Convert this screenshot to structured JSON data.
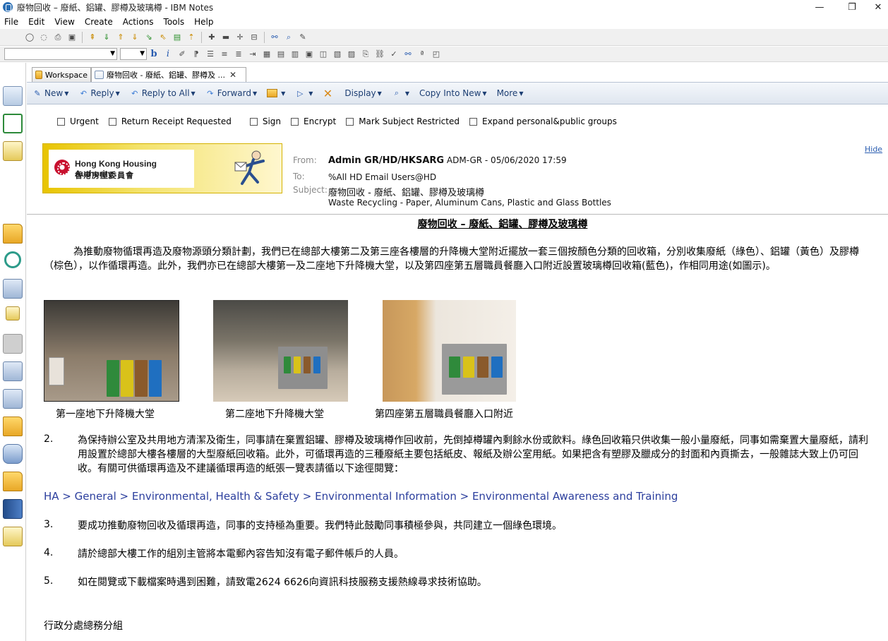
{
  "window": {
    "title": "廢物回收 – 廢紙、鋁罐、膠樽及玻璃樽 - IBM Notes",
    "min": "—",
    "max": "❐",
    "close": "✕"
  },
  "menu": [
    "File",
    "Edit",
    "View",
    "Create",
    "Actions",
    "Tools",
    "Help"
  ],
  "tabs": [
    {
      "label": "Workspace"
    },
    {
      "label": "廢物回收 - 廢紙、鋁罐、膠樽及 ..."
    }
  ],
  "tab_close": "✕",
  "actions": {
    "new": "New",
    "reply": "Reply",
    "reply_all": "Reply to All",
    "forward": "Forward",
    "display": "Display",
    "copy_into_new": "Copy Into New",
    "more": "More"
  },
  "options": {
    "urgent": "Urgent",
    "return_receipt": "Return Receipt Requested",
    "sign": "Sign",
    "encrypt": "Encrypt",
    "mark_subject_restricted": "Mark Subject Restricted",
    "expand_groups": "Expand personal&public groups"
  },
  "banner": {
    "org_en": "Hong Kong Housing Authority",
    "org_zh": "香港房屋委員會"
  },
  "header": {
    "from_label": "From:",
    "from_name": "Admin GR/HD/HKSARG",
    "from_rest": "ADM-GR  -  05/06/2020 17:59",
    "to_label": "To:",
    "to_value": "%All HD Email Users@HD",
    "subject_label": "Subject:",
    "subject_zh": "廢物回收 - 廢紙、鋁罐、膠樽及玻璃樽",
    "subject_en": "Waste Recycling - Paper, Aluminum Cans, Plastic and Glass Bottles",
    "hide": "Hide"
  },
  "body": {
    "title": "廢物回收 – 廢紙、鋁罐、膠樽及玻璃樽",
    "intro": "　　　為推動廢物循環再造及廢物源頭分類計劃，我們已在總部大樓第二及第三座各樓層的升降機大堂附近擺放一套三個按顏色分類的回收箱，分別收集廢紙（綠色）、鋁罐（黃色）及膠樽（棕色），以作循環再造。此外，我們亦已在總部大樓第一及二座地下升降機大堂，以及第四座第五層職員餐廳入口附近設置玻璃樽回收箱(藍色)，作相同用途(如圖示)。",
    "captions": [
      "第一座地下升降機大堂",
      "第二座地下升降機大堂",
      "第四座第五層職員餐廳入口附近"
    ],
    "p2_num": "2.",
    "p2": "為保持辦公室及共用地方清潔及衛生，同事請在棄置鋁罐、膠樽及玻璃樽作回收前，先倒掉樽罐內剩餘水份或飲料。綠色回收箱只供收集一般小量廢紙，同事如需棄置大量廢紙，請利用設置於總部大樓各樓層的大型廢紙回收箱。此外，可循環再造的三種廢紙主要包括紙皮、報紙及辦公室用紙。如果把含有塑膠及臘成分的封面和內頁撕去，一般雜誌大致上仍可回收。有關可供循環再造及不建議循環再造的紙張一覽表請循以下途徑閱覽：",
    "link": "HA > General > Environmental, Health & Safety > Environmental Information > Environmental Awareness and Training",
    "p3_num": "3.",
    "p3": "要成功推動廢物回收及循環再造，同事的支持極為重要。我們特此鼓勵同事積極參與，共同建立一個綠色環境。",
    "p4_num": "4.",
    "p4": "請於總部大樓工作的組別主管將本電郵內容告知沒有電子郵件帳戶的人員。",
    "p5_num": "5.",
    "p5": "如在閱覽或下載檔案時遇到困難，請致電2624 6626向資訊科技服務支援熱線尋求技術協助。",
    "signature": "行政分處總務分組"
  },
  "colors": {
    "action_text": "#1c3e73",
    "link": "#2b3e9d",
    "banner_yellow": "#e8c400",
    "bin_green": "#2f8a3b",
    "bin_yellow": "#d9c21a",
    "bin_brown": "#8a5a2b",
    "bin_blue": "#1f6fc0"
  }
}
